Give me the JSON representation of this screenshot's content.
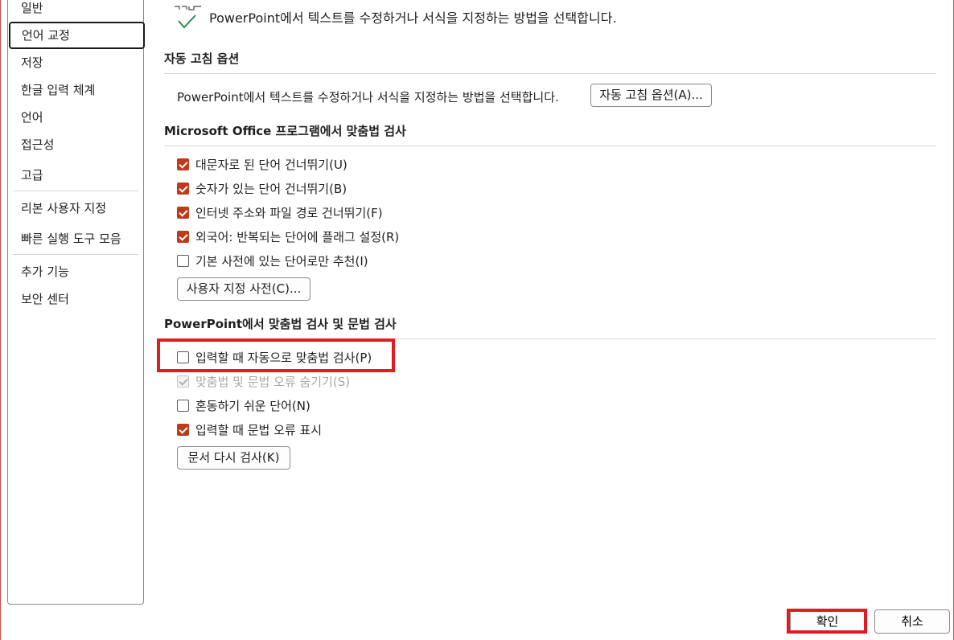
{
  "sidebar": {
    "items": [
      {
        "label": "일반"
      },
      {
        "label": "언어 교정",
        "selected": true
      },
      {
        "label": "저장"
      },
      {
        "label": "한글 입력 체계"
      },
      {
        "label": "언어"
      },
      {
        "label": "접근성"
      },
      {
        "label": "고급"
      },
      {
        "label": "리본 사용자 지정"
      },
      {
        "label": "빠른 실행 도구 모음"
      },
      {
        "label": "추가 기능"
      },
      {
        "label": "보안 센터"
      }
    ]
  },
  "header": {
    "icon": "abc-check-icon",
    "description": "PowerPoint에서 텍스트를 수정하거나 서식을 지정하는 방법을 선택합니다."
  },
  "autocorrect": {
    "title": "자동 고침 옵션",
    "description": "PowerPoint에서 텍스트를 수정하거나 서식을 지정하는 방법을 선택합니다.",
    "button_label": "자동 고침 옵션(A)..."
  },
  "office_spelling": {
    "title": "Microsoft Office 프로그램에서 맞춤법 검사",
    "options": [
      {
        "label": "대문자로 된 단어 건너뛰기(U)",
        "checked": true
      },
      {
        "label": "숫자가 있는 단어 건너뛰기(B)",
        "checked": true
      },
      {
        "label": "인터넷 주소와 파일 경로 건너뛰기(F)",
        "checked": true
      },
      {
        "label": "외국어: 반복되는 단어에 플래그 설정(R)",
        "checked": true
      },
      {
        "label": "기본 사전에 있는 단어로만 추천(I)",
        "checked": false
      }
    ],
    "dictionary_button": "사용자 지정 사전(C)..."
  },
  "ppt_spelling": {
    "title": "PowerPoint에서 맞춤법 검사 및 문법 검사",
    "options": [
      {
        "label": "입력할 때 자동으로 맞춤법 검사(P)",
        "checked": false,
        "disabled": false
      },
      {
        "label": "맞춤법 및 문법 오류 숨기기(S)",
        "checked": true,
        "disabled": true
      },
      {
        "label": "혼동하기 쉬운 단어(N)",
        "checked": false,
        "disabled": false
      },
      {
        "label": "입력할 때 문법 오류 표시",
        "checked": true,
        "disabled": false
      }
    ],
    "recheck_button": "문서 다시 검사(K)"
  },
  "footer": {
    "ok_label": "확인",
    "cancel_label": "취소"
  },
  "colors": {
    "accent": "#c0391b",
    "highlight": "#e01b24"
  }
}
